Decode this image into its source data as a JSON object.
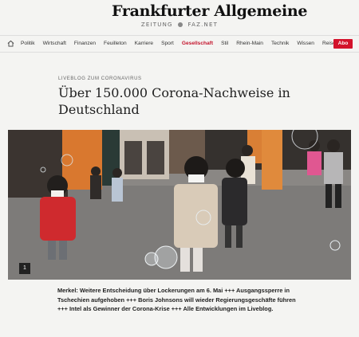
{
  "brand": {
    "logo": "Frankfurter Allgemeine",
    "subline_left": "ZEITUNG",
    "subline_right": "FAZ.NET"
  },
  "nav": {
    "items": [
      "Politik",
      "Wirtschaft",
      "Finanzen",
      "Feuilleton",
      "Karriere",
      "Sport",
      "Gesellschaft",
      "Stil",
      "Rhein-Main",
      "Technik",
      "Wissen",
      "Reise"
    ],
    "active": "Gesellschaft",
    "abo_label": "Abo",
    "home_icon": "home-icon",
    "accent": "#d3122b"
  },
  "article": {
    "kicker": "LIVEBLOG ZUM CORONAVIRUS",
    "headline": "Über 150.000 Corona-Nachweise in Deutschland",
    "photo_counter": "1",
    "teaser": "Merkel: Weitere Entscheidung über Lockerungen am 6. Mai +++ Ausgangssperre in Tschechien aufgehoben +++ Boris Johnsons will wieder Regierungsgeschäfte führen +++ Intel als Gewinner der Corona-Krise +++ Alle Entwicklungen im Liveblog."
  }
}
